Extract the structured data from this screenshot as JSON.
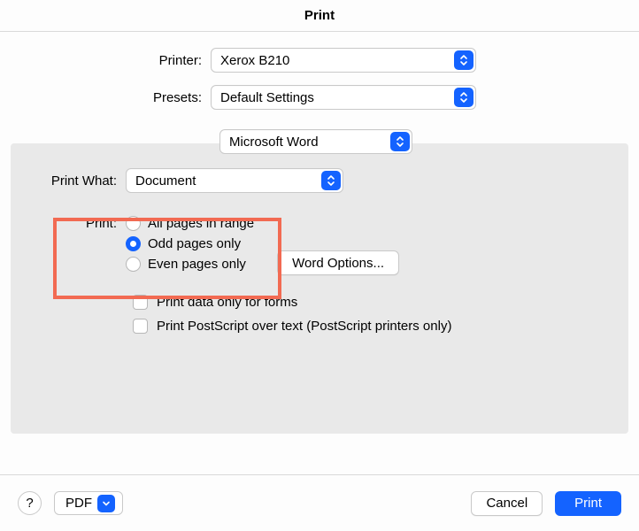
{
  "title": "Print",
  "top": {
    "printer_label": "Printer:",
    "printer_value": "Xerox B210",
    "presets_label": "Presets:",
    "presets_value": "Default Settings"
  },
  "app_select": {
    "value": "Microsoft Word"
  },
  "panel": {
    "print_what_label": "Print What:",
    "print_what_value": "Document",
    "print_label": "Print:",
    "options": {
      "all": "All pages in range",
      "odd": "Odd pages only",
      "even": "Even pages only"
    },
    "selected": "odd",
    "word_options_btn": "Word Options...",
    "cb_forms": "Print data only for forms",
    "cb_postscript": "Print PostScript over text (PostScript printers only)"
  },
  "footer": {
    "help": "?",
    "pdf": "PDF",
    "cancel": "Cancel",
    "print": "Print"
  }
}
